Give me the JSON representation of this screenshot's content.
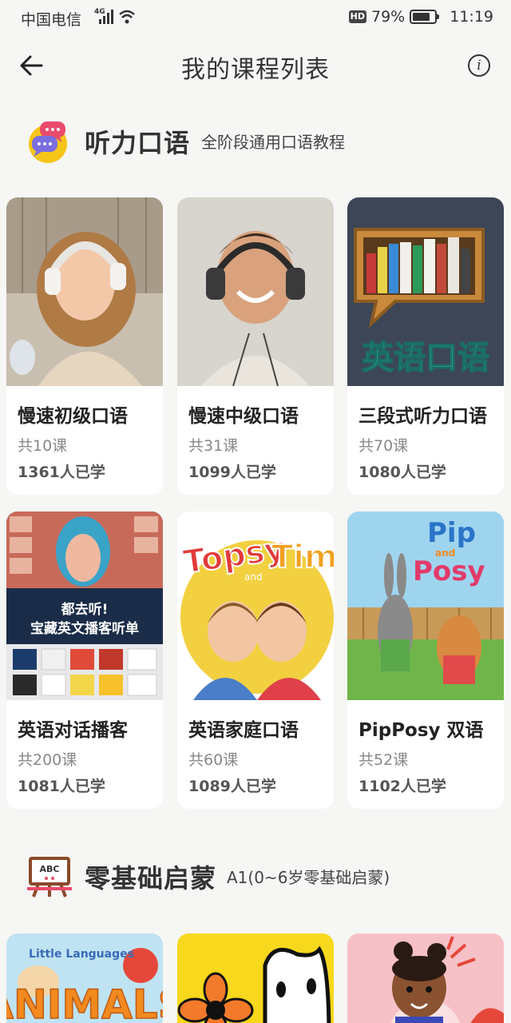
{
  "status_bar": {
    "carrier": "中国电信",
    "network": "4G",
    "battery_percent": "79%",
    "battery_level": 0.79,
    "time": "11:19",
    "hd": "HD"
  },
  "header": {
    "title": "我的课程列表",
    "info_glyph": "i"
  },
  "sections": [
    {
      "title": "听力口语",
      "subtitle": "全阶段通用口语教程",
      "icon": "chat-bubbles-icon",
      "courses": [
        {
          "title": "慢速初级口语",
          "lessons": "共10课",
          "learners": "1361人已学"
        },
        {
          "title": "慢速中级口语",
          "lessons": "共31课",
          "learners": "1099人已学"
        },
        {
          "title": "三段式听力口语",
          "lessons": "共70课",
          "learners": "1080人已学",
          "cover_text": "英语口语"
        },
        {
          "title": "英语对话播客",
          "lessons": "共200课",
          "learners": "1081人已学",
          "cover_text_1": "都去听!",
          "cover_text_2": "宝藏英文播客听单"
        },
        {
          "title": "英语家庭口语",
          "lessons": "共60课",
          "learners": "1089人已学",
          "cover_text_1": "Topsy",
          "cover_text_2": "and",
          "cover_text_3": "Tim"
        },
        {
          "title": "PipPosy 双语",
          "lessons": "共52课",
          "learners": "1102人已学",
          "cover_text_1": "Pip",
          "cover_text_2": "and",
          "cover_text_3": "Posy"
        }
      ]
    },
    {
      "title": "零基础启蒙",
      "subtitle": "A1(0~6岁零基础启蒙)",
      "icon": "chalkboard-abc-icon",
      "board_text": "ABC",
      "courses": [
        {
          "cover_text_1": "Little Languages",
          "cover_text_2": "ANIMALS"
        },
        {
          "cover_text_1": ""
        },
        {
          "cover_text_1": ""
        }
      ]
    }
  ],
  "colors": {
    "background": "#f6f6f4",
    "card": "#ffffff",
    "accent_yellow": "#f5c518",
    "accent_pink": "#e94b6b"
  }
}
